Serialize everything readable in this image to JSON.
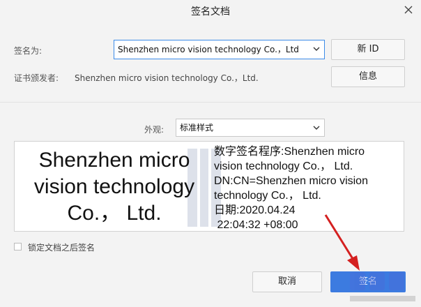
{
  "dialog": {
    "title": "签名文档"
  },
  "sign_as": {
    "label": "签名为:",
    "selected": "Shenzhen micro vision technology Co.，Ltd",
    "new_id_button": "新 ID"
  },
  "issuer": {
    "label": "证书颁发者:",
    "value": "Shenzhen micro vision technology Co.，Ltd.",
    "info_button": "信息"
  },
  "appearance": {
    "label": "外观:",
    "selected": "标准样式"
  },
  "preview": {
    "name_lines": [
      "Shenzhen micro",
      "vision technology",
      "Co.， Ltd."
    ],
    "detail_lines": [
      "数字签名程序:Shenzhen micro",
      "vision technology  Co.， Ltd.",
      "DN:CN=Shenzhen micro vision",
      "technology  Co.， Ltd.",
      "日期:2020.04.24",
      " 22:04:32 +08:00"
    ]
  },
  "lock_checkbox": {
    "label": "锁定文档之后签名",
    "checked": false
  },
  "footer": {
    "cancel": "取消",
    "sign": "签名"
  },
  "colors": {
    "primary": "#3c7be0",
    "annotation_arrow": "#d42020"
  },
  "icons": {
    "close": "close-icon",
    "dropdown": "chevron-down-icon",
    "watermark": "site-watermark-logo"
  }
}
